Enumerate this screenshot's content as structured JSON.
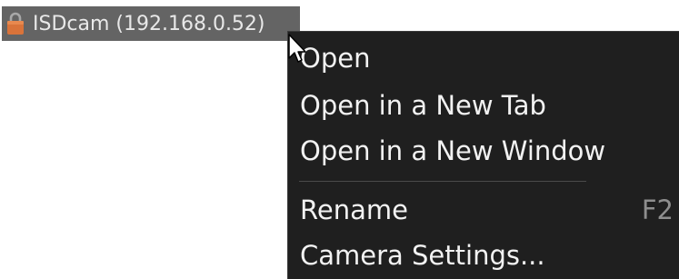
{
  "tree": {
    "item_label": "ISDcam (192.168.0.52)",
    "icon": "lock-icon"
  },
  "context_menu": {
    "items": [
      {
        "label": "Open",
        "shortcut": ""
      },
      {
        "label": "Open in a New Tab",
        "shortcut": ""
      },
      {
        "label": "Open in a New Window",
        "shortcut": ""
      },
      {
        "label": "Rename",
        "shortcut": "F2"
      },
      {
        "label": "Camera Settings...",
        "shortcut": ""
      }
    ]
  },
  "colors": {
    "tree_item_bg": "#646464",
    "menu_bg": "#1f1f1f",
    "menu_text": "#f2f2f2",
    "shortcut_text": "#8e8e8e",
    "lock_icon": "#d9733a"
  }
}
